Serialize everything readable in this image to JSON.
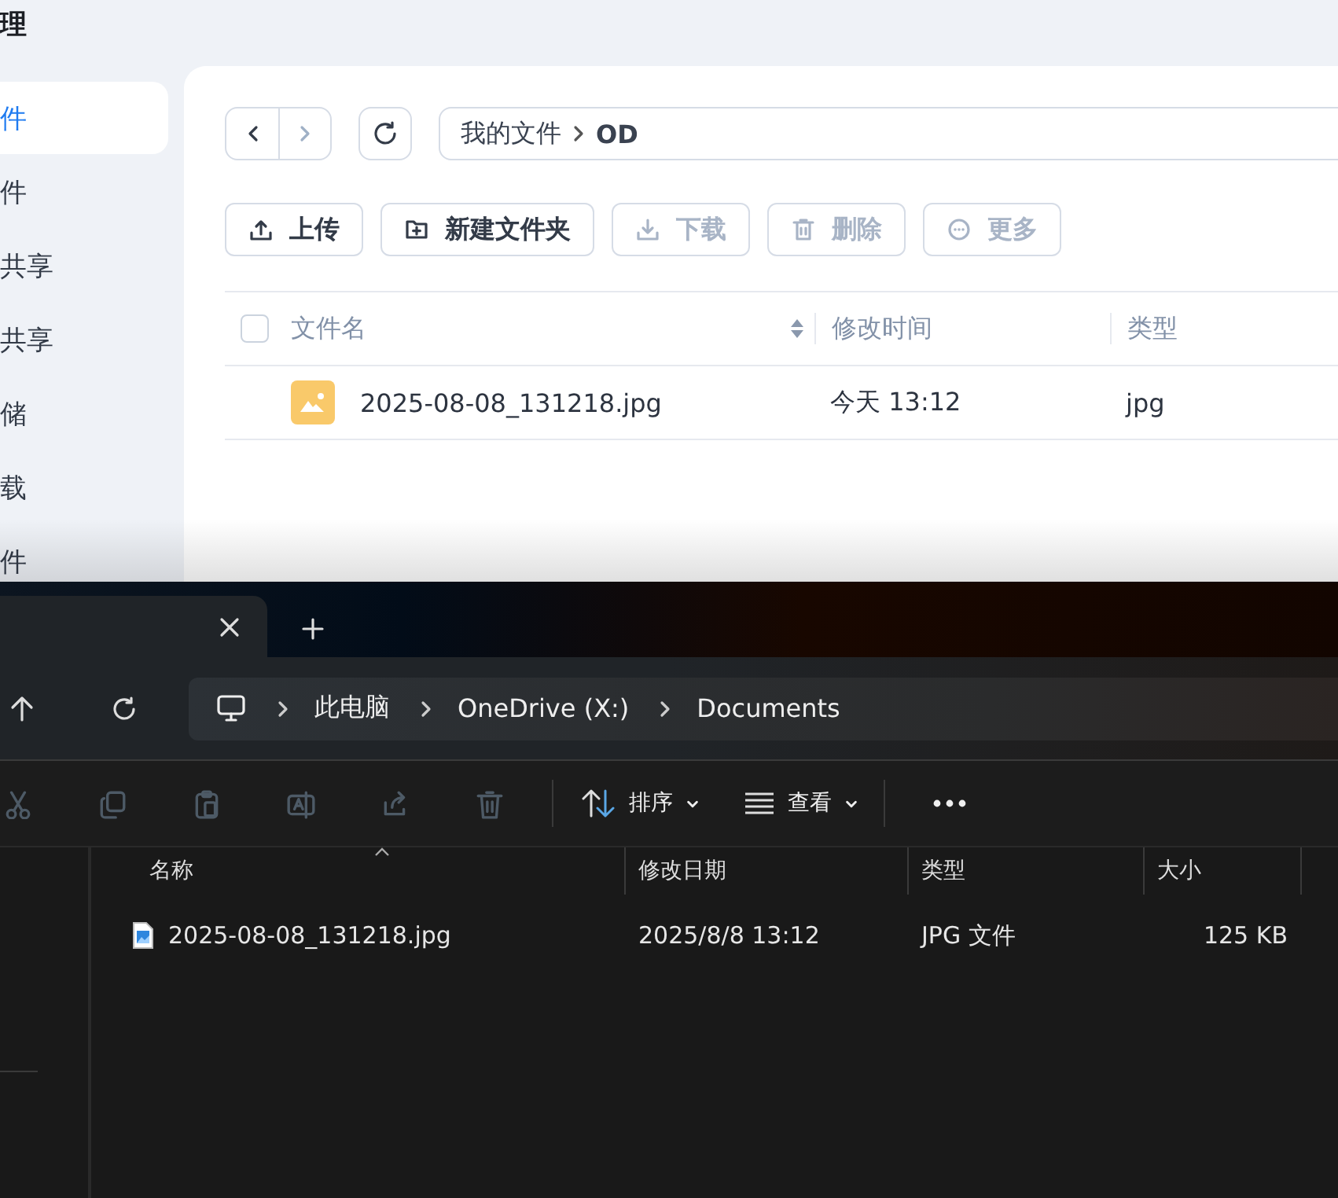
{
  "web_app": {
    "title": "理",
    "sidebar": {
      "items": [
        {
          "label": "件",
          "selected": true
        },
        {
          "label": "件",
          "selected": false
        },
        {
          "label": "共享",
          "selected": false
        },
        {
          "label": "共享",
          "selected": false
        },
        {
          "label": "储",
          "selected": false
        },
        {
          "label": "载",
          "selected": false
        },
        {
          "label": "件",
          "selected": false
        }
      ]
    },
    "nav": {
      "back_disabled": false,
      "forward_disabled": true
    },
    "path": [
      "我的文件",
      "OD"
    ],
    "toolbar": [
      {
        "kind": "upload",
        "label": "上传",
        "disabled": false
      },
      {
        "kind": "new-folder",
        "label": "新建文件夹",
        "disabled": false
      },
      {
        "kind": "download",
        "label": "下载",
        "disabled": true
      },
      {
        "kind": "delete",
        "label": "删除",
        "disabled": true
      },
      {
        "kind": "more",
        "label": "更多",
        "disabled": true
      }
    ],
    "table": {
      "select_all_checked": false,
      "columns": [
        {
          "label": "文件名",
          "sortable": true
        },
        {
          "label": "修改时间",
          "sortable": false
        },
        {
          "label": "类型",
          "sortable": false
        }
      ],
      "rows": [
        {
          "name": "2025-08-08_131218.jpg",
          "modified": "今天 13:12",
          "type": "jpg"
        }
      ]
    }
  },
  "explorer": {
    "breadcrumb": [
      "此电脑",
      "OneDrive (X:)",
      "Documents"
    ],
    "commands": [
      {
        "kind": "cut",
        "disabled": true
      },
      {
        "kind": "copy",
        "disabled": true
      },
      {
        "kind": "paste",
        "disabled": true
      },
      {
        "kind": "rename",
        "disabled": true
      },
      {
        "kind": "share",
        "disabled": true
      },
      {
        "kind": "delete",
        "disabled": true
      }
    ],
    "sort_label": "排序",
    "view_label": "查看",
    "columns": [
      {
        "label": "名称",
        "sorted": true
      },
      {
        "label": "修改日期",
        "sorted": false
      },
      {
        "label": "类型",
        "sorted": false
      },
      {
        "label": "大小",
        "sorted": false
      }
    ],
    "rows": [
      {
        "name": "2025-08-08_131218.jpg",
        "modified": "2025/8/8 13:12",
        "type": "JPG 文件",
        "size": "125 KB"
      }
    ]
  }
}
